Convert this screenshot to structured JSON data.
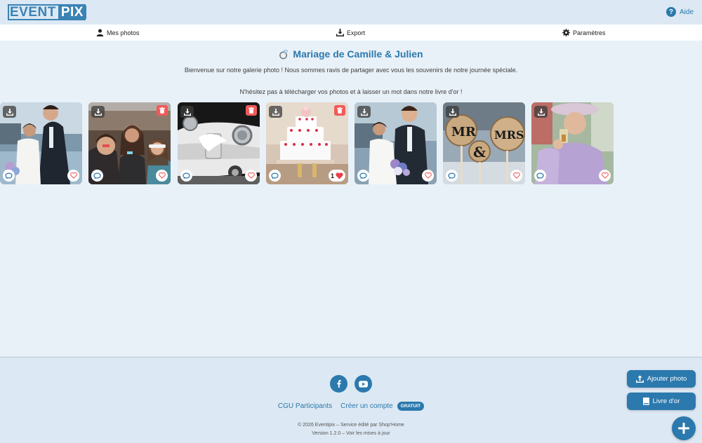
{
  "brand": {
    "logo_part1": "EVENT",
    "logo_part2": "PIX"
  },
  "header": {
    "help_label": "Aide"
  },
  "nav": {
    "my_photos": "Mes photos",
    "export": "Export",
    "settings": "Paramètres"
  },
  "event": {
    "title": "Mariage de Camille & Julien",
    "welcome": "Bienvenue sur notre galerie photo ! Nous sommes ravis de partager avec vous les souvenirs de notre journée spéciale.",
    "invite": "N'hésitez pas à télécharger vos photos et à laisser un mot dans notre livre d'or !"
  },
  "photos": [
    {
      "subject": "couple on waterfront",
      "deletable": false,
      "likes": ""
    },
    {
      "subject": "friends photo booth",
      "deletable": true,
      "likes": ""
    },
    {
      "subject": "vintage wedding car",
      "deletable": true,
      "likes": ""
    },
    {
      "subject": "wedding cake",
      "deletable": true,
      "likes": "1",
      "liked": true
    },
    {
      "subject": "bride and groom",
      "deletable": false,
      "likes": ""
    },
    {
      "subject": "mr and mrs signs",
      "deletable": false,
      "likes": ""
    },
    {
      "subject": "elderly guest toasting",
      "deletable": false,
      "likes": ""
    }
  ],
  "footer": {
    "cgu": "CGU Participants",
    "create_account": "Créer un compte",
    "badge": "GRATUIT",
    "copyright": "© 2026 Eventipix – Service édité par Shop'Home",
    "version": "Version 1.2.0 – Voir les mises à jour"
  },
  "actions": {
    "add_photo": "Ajouter photo",
    "guestbook": "Livre d'or"
  },
  "colors": {
    "accent": "#2b79ad",
    "delete": "#f15a5a",
    "background": "#e9f1f8"
  }
}
